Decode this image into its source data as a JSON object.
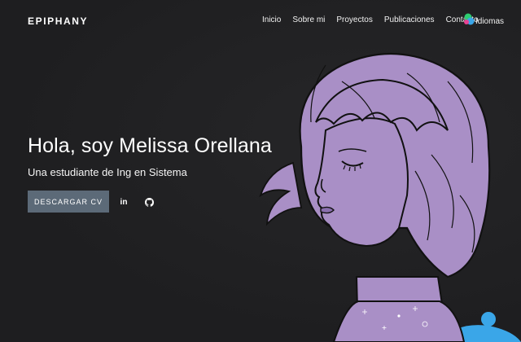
{
  "header": {
    "brand": "EPIPHANY",
    "nav": [
      "Inicio",
      "Sobre mi",
      "Proyectos",
      "Publicaciones",
      "Contacto"
    ],
    "language_label": "Idiomas"
  },
  "hero": {
    "title": "Hola, soy Melissa Orellana",
    "subtitle": "Una estudiante de Ing en Sistema",
    "cv_button": "DESCARGAR CV",
    "linkedin_label": "in"
  },
  "colors": {
    "background": "#1f1f21",
    "button": "#5c6a78",
    "illustration_purple": "#a98fc6",
    "accent_blue": "#3aa6e8"
  },
  "icons": [
    "translate-icon",
    "linkedin-icon",
    "github-icon"
  ]
}
